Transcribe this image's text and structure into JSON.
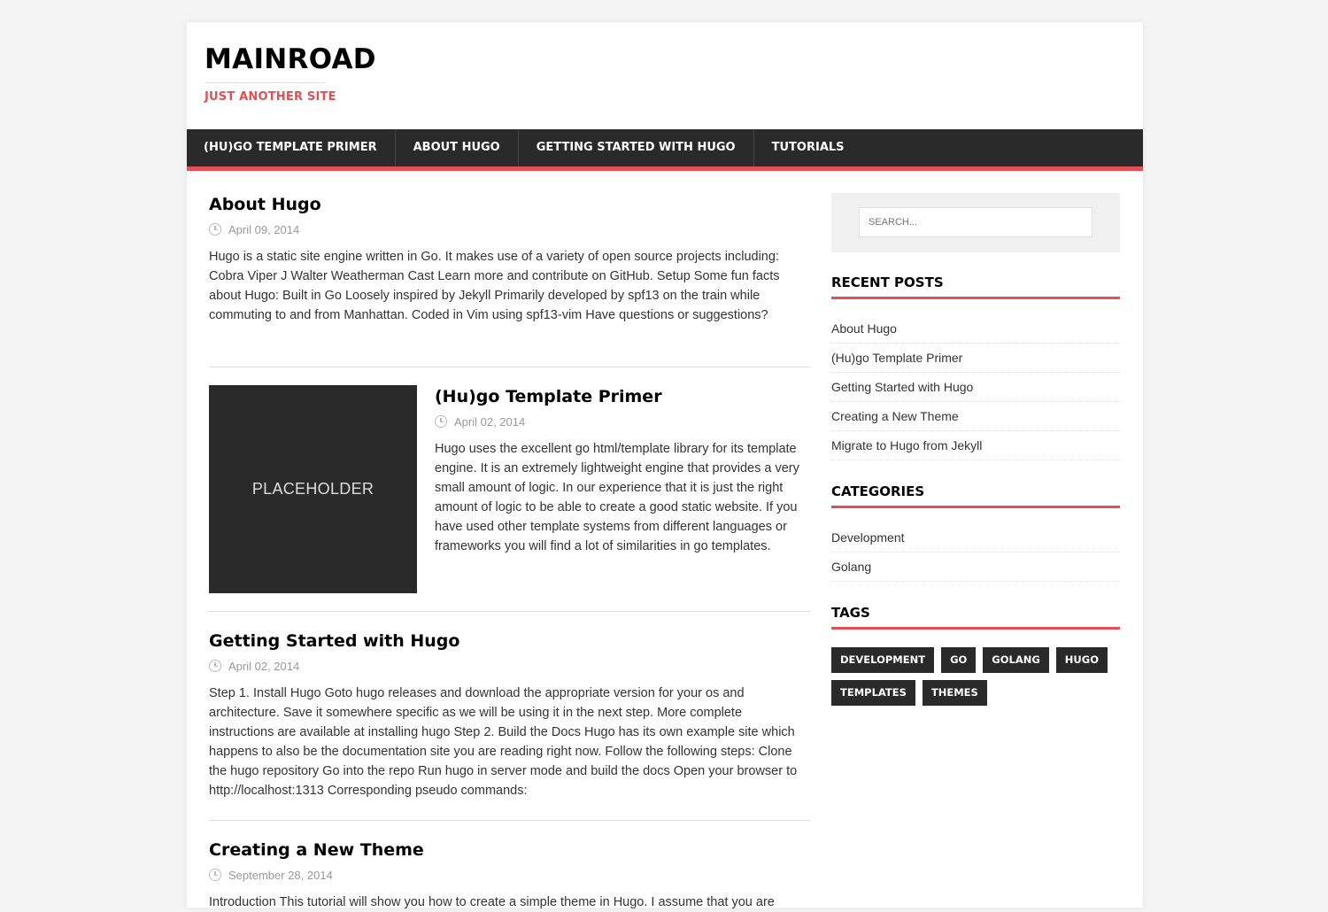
{
  "site": {
    "title": "MAINROAD",
    "tagline": "JUST ANOTHER SITE"
  },
  "nav": {
    "items": [
      {
        "label": "(HU)GO TEMPLATE PRIMER"
      },
      {
        "label": "ABOUT HUGO"
      },
      {
        "label": "GETTING STARTED WITH HUGO"
      },
      {
        "label": "TUTORIALS"
      }
    ]
  },
  "posts": [
    {
      "title": "About Hugo",
      "date": "April 09, 2014",
      "excerpt": "Hugo is a static site engine written in Go. It makes use of a variety of open source projects including: Cobra Viper J Walter Weatherman Cast Learn more and contribute on GitHub. Setup Some fun facts about Hugo: Built in Go Loosely inspired by Jekyll Primarily developed by spf13 on the train while commuting to and from Manhattan. Coded in Vim using spf13-vim Have questions or suggestions?"
    },
    {
      "title": "(Hu)go Template Primer",
      "date": "April 02, 2014",
      "thumbnail": "PLACEHOLDER",
      "excerpt": "Hugo uses the excellent go html/template library for its template engine. It is an extremely lightweight engine that provides a very small amount of logic. In our experience that it is just the right amount of logic to be able to create a good static website. If you have used other template systems from different languages or frameworks you will find a lot of similarities in go templates."
    },
    {
      "title": "Getting Started with Hugo",
      "date": "April 02, 2014",
      "excerpt": "Step 1. Install Hugo Goto hugo releases and download the appropriate version for your os and architecture. Save it somewhere specific as we will be using it in the next step. More complete instructions are available at installing hugo Step 2. Build the Docs Hugo has its own example site which happens to also be the documentation site you are reading right now. Follow the following steps: Clone the hugo repository Go into the repo Run hugo in server mode and build the docs Open your browser to http://localhost:1313 Corresponding pseudo commands:"
    },
    {
      "title": "Creating a New Theme",
      "date": "September 28, 2014",
      "excerpt": "Introduction This tutorial will show you how to create a simple theme in Hugo. I assume that you are"
    }
  ],
  "sidebar": {
    "search_placeholder": "SEARCH...",
    "recent_posts": {
      "title": "RECENT POSTS",
      "items": [
        "About Hugo",
        "(Hu)go Template Primer",
        "Getting Started with Hugo",
        "Creating a New Theme",
        "Migrate to Hugo from Jekyll"
      ]
    },
    "categories": {
      "title": "CATEGORIES",
      "items": [
        "Development",
        "Golang"
      ]
    },
    "tags": {
      "title": "TAGS",
      "items": [
        "DEVELOPMENT",
        "GO",
        "GOLANG",
        "HUGO",
        "TEMPLATES",
        "THEMES"
      ]
    }
  },
  "colors": {
    "accent": "#e54e53",
    "dark": "#2a2a2a"
  }
}
